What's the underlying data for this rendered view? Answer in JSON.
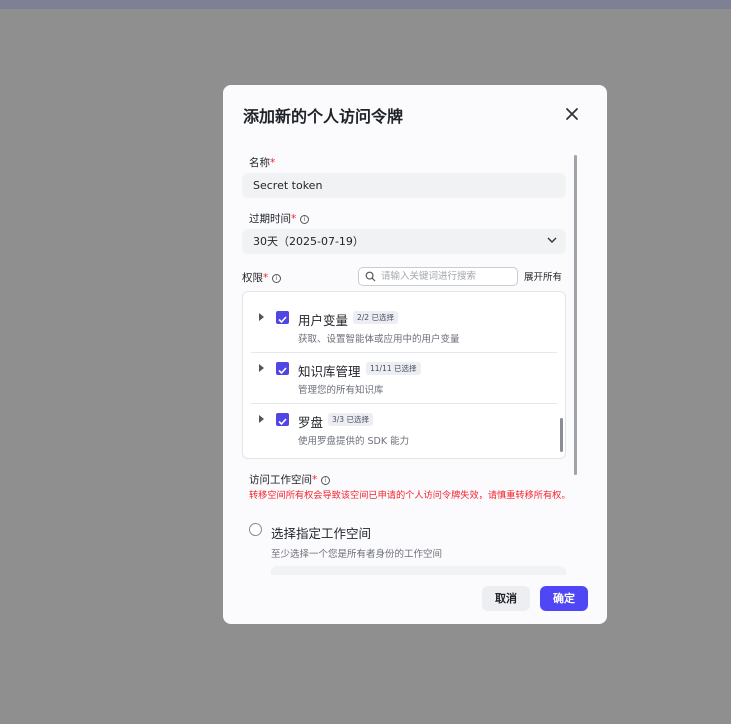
{
  "modal": {
    "title": "添加新的个人访问令牌",
    "name_label": "名称",
    "name_value": "Secret token",
    "expiry_label": "过期时间",
    "expiry_value": "30天（2025-07-19）",
    "permissions_label": "权限",
    "search_placeholder": "请输入关键词进行搜索",
    "expand_all": "展开所有",
    "permissions": [
      {
        "name": "用户变量",
        "badge": "2/2 已选择",
        "desc": "获取、设置智能体或应用中的用户变量"
      },
      {
        "name": "知识库管理",
        "badge": "11/11 已选择",
        "desc": "管理您的所有知识库"
      },
      {
        "name": "罗盘",
        "badge": "3/3 已选择",
        "desc": "使用罗盘提供的 SDK 能力"
      }
    ],
    "workspace_label": "访问工作空间",
    "workspace_warning": "转移空间所有权会导致该空间已申请的个人访问令牌失效，请慎重转移所有权。",
    "workspace_option_label": "选择指定工作空间",
    "workspace_option_desc": "至少选择一个您是所有者身份的工作空间",
    "cancel": "取消",
    "confirm": "确定"
  },
  "colors": {
    "accent": "#4f46f5",
    "required": "#f5222d",
    "overlay": "#8f8f90"
  }
}
